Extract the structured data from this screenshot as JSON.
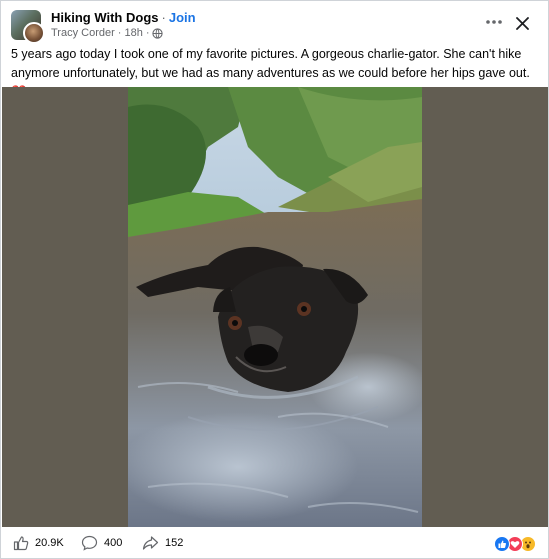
{
  "header": {
    "group_name": "Hiking With Dogs",
    "separator": "·",
    "join_label": "Join",
    "author": "Tracy Corder",
    "time": "18h",
    "meta_dot": "·",
    "more_icon": "more-horizontal-icon",
    "close_icon": "close-icon",
    "privacy_icon": "globe-icon"
  },
  "post": {
    "text": "5 years ago today I took one of my favorite pictures. A gorgeous charlie-gator. She can't hike anymore unfortunately, but we had as many adventures as we could before her hips gave out.",
    "emoji": "❤️"
  },
  "footer": {
    "likes_count": "20.9K",
    "comments_count": "400",
    "shares_count": "152",
    "like_icon": "thumbs-up-icon",
    "comment_icon": "comment-bubble-icon",
    "share_icon": "share-arrow-icon",
    "reaction_icons": [
      "like-reaction-icon",
      "love-reaction-icon",
      "wow-reaction-icon"
    ]
  },
  "colors": {
    "accent": "#1b74e4",
    "media_background": "#625d52",
    "secondary_text": "#65676b"
  }
}
